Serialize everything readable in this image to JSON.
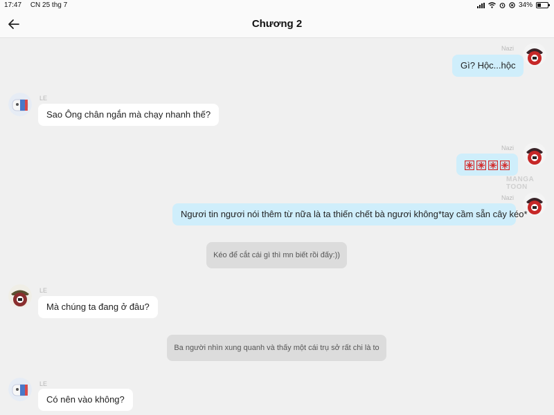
{
  "status_bar": {
    "time": "17:47",
    "date": "CN 25 thg 7",
    "battery": "34%"
  },
  "header": {
    "title": "Chương 2",
    "back_icon": "arrow-left-icon"
  },
  "watermark": "MANGA TOON",
  "messages": [
    {
      "side": "right",
      "sender": "Nazi",
      "text": "Gì? Hộc...hộc"
    },
    {
      "side": "left",
      "sender": "LE",
      "text": "Sao Ông chân ngắn mà chạy nhanh thế?"
    },
    {
      "side": "right",
      "sender": "Nazi",
      "text": "",
      "emoji": "anger-symbol-icon ×4"
    },
    {
      "side": "right",
      "sender": "Nazi",
      "text": "Ngươi tin ngươi nói thêm từ nữa là ta thiến chết bà ngươi không*tay cầm sẵn cây kéo*"
    },
    {
      "side": "narration",
      "text": "Kéo để cắt cái gì thì mn biết rồi đấy:))"
    },
    {
      "side": "left",
      "sender": "LE",
      "text": "Mà chúng ta đang ở đâu?"
    },
    {
      "side": "narration",
      "text": "Ba người nhìn xung quanh và thấy một cái trụ sở rất chi là to"
    },
    {
      "side": "left",
      "sender": "LE",
      "text": "Có nên vào không?"
    }
  ]
}
